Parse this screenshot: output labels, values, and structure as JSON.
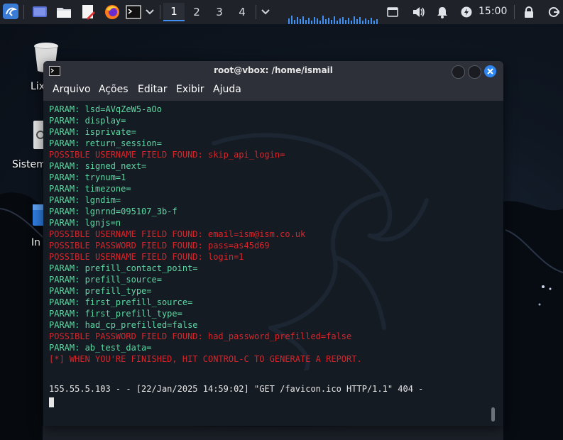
{
  "panel": {
    "workspaces": [
      "1",
      "2",
      "3",
      "4"
    ],
    "active_workspace": "1",
    "clock": "15:00",
    "icons": [
      "kali-menu-icon",
      "show-desktop-icon",
      "file-manager-icon",
      "text-editor-icon",
      "firefox-icon",
      "terminal-icon",
      "chevron-down-icon",
      "screen-capture-icon",
      "volume-icon",
      "bell-icon",
      "power-manager-icon",
      "lock-icon",
      "logout-icon"
    ]
  },
  "desktop": {
    "icons": [
      {
        "label": "Lix"
      },
      {
        "label": "Sistem"
      },
      {
        "label": "In"
      }
    ]
  },
  "window": {
    "title": "root@vbox: /home/ismail",
    "menu": [
      "Arquivo",
      "Ações",
      "Editar",
      "Exibir",
      "Ajuda"
    ]
  },
  "terminal": {
    "lines": [
      {
        "text": "PARAM: lsd=AVqZeW5-aOo",
        "color": "green"
      },
      {
        "text": "PARAM: display=",
        "color": "green"
      },
      {
        "text": "PARAM: isprivate=",
        "color": "green"
      },
      {
        "text": "PARAM: return_session=",
        "color": "green"
      },
      {
        "text": "POSSIBLE USERNAME FIELD FOUND: skip_api_login=",
        "color": "red"
      },
      {
        "text": "PARAM: signed_next=",
        "color": "green"
      },
      {
        "text": "PARAM: trynum=1",
        "color": "green"
      },
      {
        "text": "PARAM: timezone=",
        "color": "green"
      },
      {
        "text": "PARAM: lgndim=",
        "color": "green"
      },
      {
        "text": "PARAM: lgnrnd=095107_3b-f",
        "color": "green"
      },
      {
        "text": "PARAM: lgnjs=n",
        "color": "green"
      },
      {
        "text": "POSSIBLE USERNAME FIELD FOUND: email=ism@ism.co.uk",
        "color": "red"
      },
      {
        "text": "POSSIBLE PASSWORD FIELD FOUND: pass=as45d69",
        "color": "red"
      },
      {
        "text": "POSSIBLE USERNAME FIELD FOUND: login=1",
        "color": "red"
      },
      {
        "text": "PARAM: prefill_contact_point=",
        "color": "green"
      },
      {
        "text": "PARAM: prefill_source=",
        "color": "green"
      },
      {
        "text": "PARAM: prefill_type=",
        "color": "green"
      },
      {
        "text": "PARAM: first_prefill_source=",
        "color": "green"
      },
      {
        "text": "PARAM: first_prefill_type=",
        "color": "green"
      },
      {
        "text": "PARAM: had_cp_prefilled=false",
        "color": "green"
      },
      {
        "text": "POSSIBLE PASSWORD FIELD FOUND: had_password_prefilled=false",
        "color": "red"
      },
      {
        "text": "PARAM: ab_test_data=",
        "color": "green"
      },
      {
        "text": "[*] WHEN YOU'RE FINISHED, HIT CONTROL-C TO GENERATE A REPORT.",
        "color": "red"
      }
    ],
    "log_line": "155.55.5.103 - - [22/Jan/2025 14:59:02] \"GET /favicon.ico HTTP/1.1\" 404 -"
  },
  "colors": {
    "green": "#5fd7a3",
    "red": "#d7262b",
    "accent": "#3f8ff5",
    "panel_bg": "#1f2229",
    "terminal_bg": "#151b23"
  }
}
